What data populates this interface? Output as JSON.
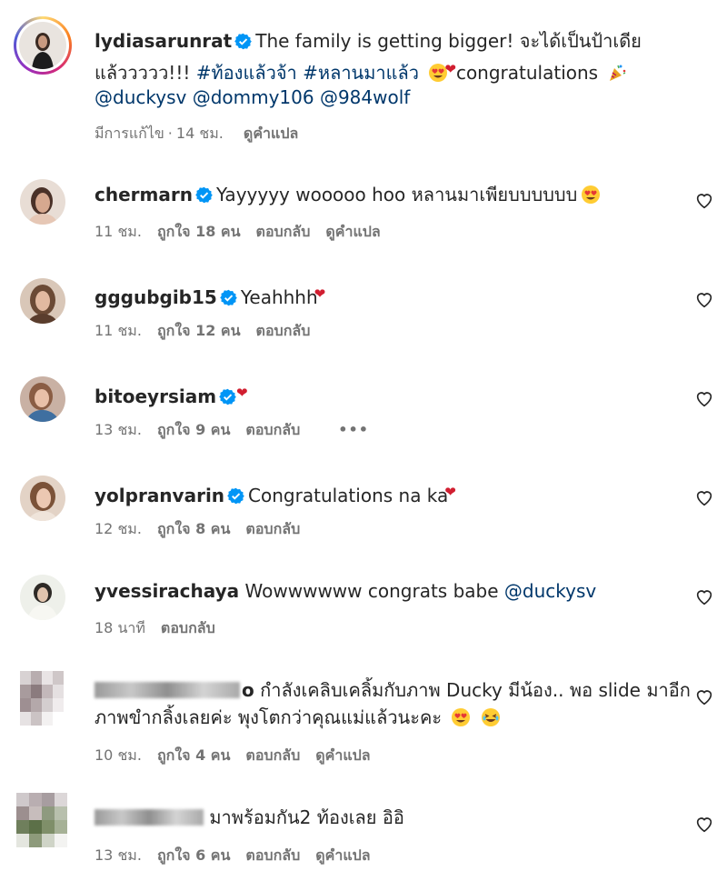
{
  "caption": {
    "username": "lydiasarunrat",
    "line1_text": "The family is getting bigger! จะได้เป็นป้าเดีย",
    "line2_text": "แล้ววววว!!!",
    "hashtags": [
      "#ท้องแล้วจ้า",
      "#หลานมาแล้ว"
    ],
    "line2_tail": "congratulations",
    "mentions": [
      "@duckysv",
      "@dommy106",
      "@984wolf"
    ],
    "edited_label": "มีการแก้ไข",
    "time": "14 ชม.",
    "translate": "ดูคำแปล"
  },
  "comments": [
    {
      "username": "chermarn",
      "verified": true,
      "text": "Yayyyyy wooooo hoo หลานมาเพียบบบบบบ",
      "time": "11 ชม.",
      "likes": "ถูกใจ 18 คน",
      "reply": "ตอบกลับ",
      "translate": "ดูคำแปล"
    },
    {
      "username": "gggubgib15",
      "verified": true,
      "text": "Yeahhhh",
      "time": "11 ชม.",
      "likes": "ถูกใจ 12 คน",
      "reply": "ตอบกลับ"
    },
    {
      "username": "bitoeyrsiam",
      "verified": true,
      "text": "",
      "time": "13 ชม.",
      "likes": "ถูกใจ 9 คน",
      "reply": "ตอบกลับ",
      "more": "•••"
    },
    {
      "username": "yolpranvarin",
      "verified": true,
      "text": "Congratulations na ka",
      "time": "12 ชม.",
      "likes": "ถูกใจ 8 คน",
      "reply": "ตอบกลับ"
    },
    {
      "username": "yvessirachaya",
      "verified": false,
      "text": "Wowwwwww congrats babe",
      "mention": "@duckysv",
      "time": "18 นาที",
      "reply": "ตอบกลับ"
    },
    {
      "username_visible": "o",
      "line1": "กำลังเคลิบเคลิ้มกับภาพ Ducky มีน้อง.. พอ slide มาอีก",
      "line2": "ภาพขำกลิ้งเลยค่ะ พุงโตกว่าคุณแม่แล้วนะคะ",
      "time": "10 ชม.",
      "likes": "ถูกใจ 4 คน",
      "reply": "ตอบกลับ",
      "translate": "ดูคำแปล"
    },
    {
      "text": "มาพร้อมกัน2 ท้องเลย อิอิ",
      "time": "13 ชม.",
      "likes": "ถูกใจ 6 คน",
      "reply": "ตอบกลับ",
      "translate": "ดูคำแปล"
    }
  ],
  "colors": {
    "text": "#262626",
    "meta": "#737373",
    "link": "#00376b",
    "verified": "#0095f6",
    "heart_emoji": "#d11e30"
  }
}
